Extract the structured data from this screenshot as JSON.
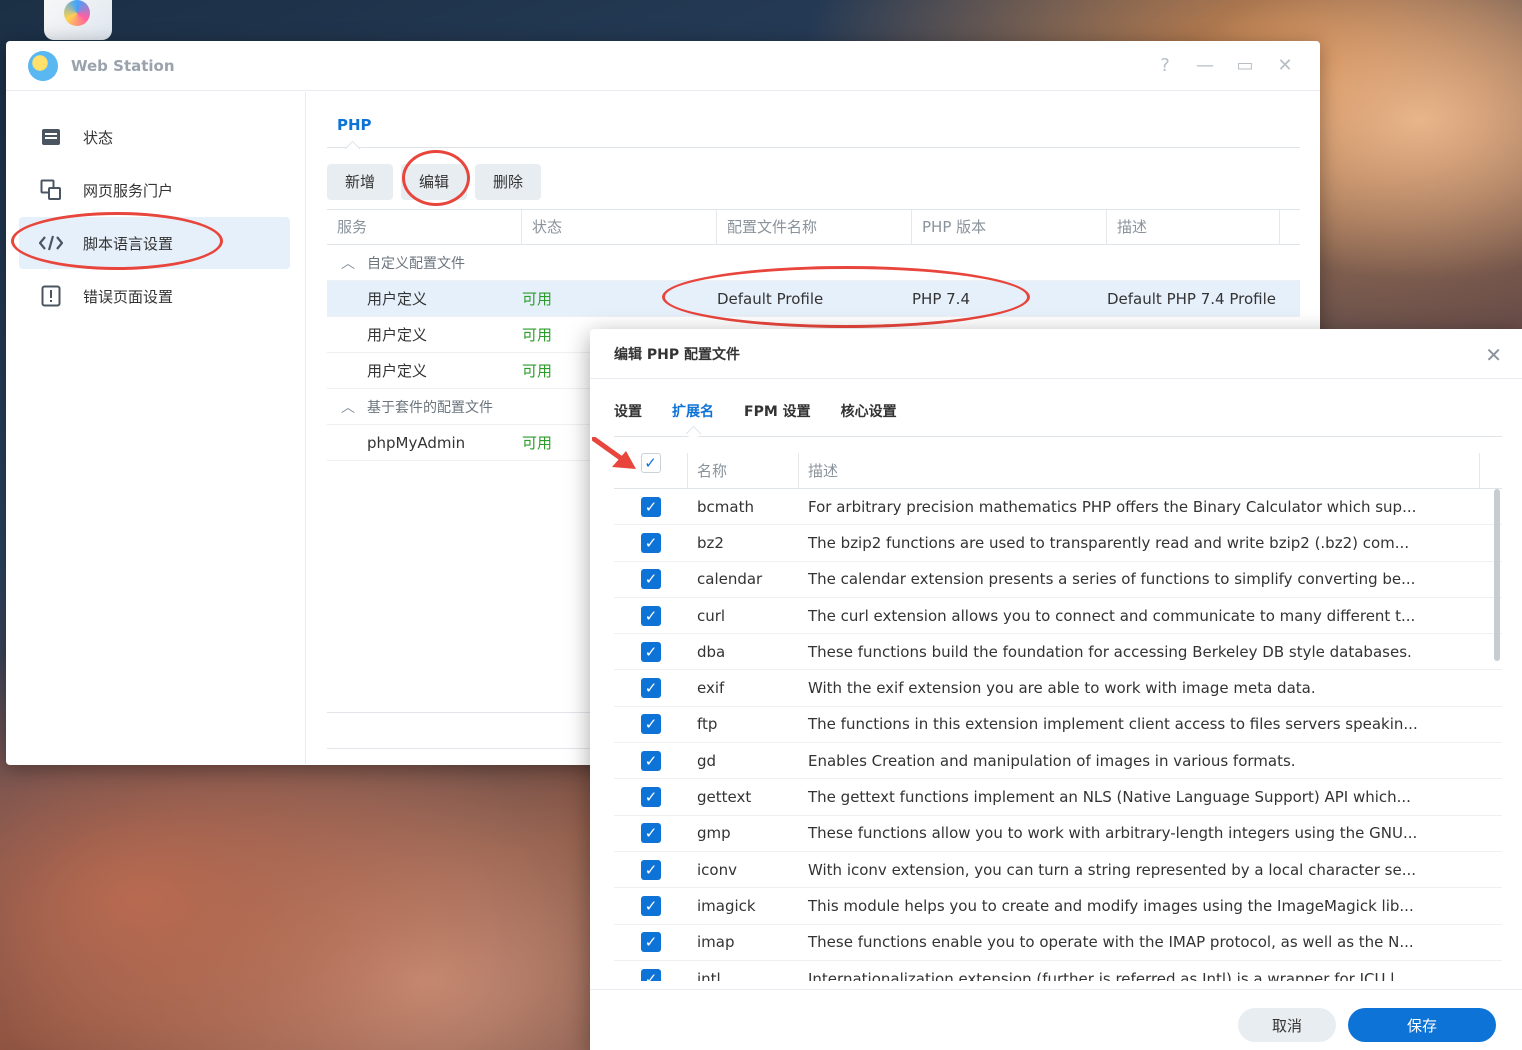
{
  "window": {
    "title": "Web Station",
    "controls": [
      "?",
      "—",
      "▭",
      "✕"
    ]
  },
  "sidebar": {
    "items": [
      {
        "label": "状态",
        "icon": "status-icon"
      },
      {
        "label": "网页服务门户",
        "icon": "portal-icon"
      },
      {
        "label": "脚本语言设置",
        "icon": "code-icon",
        "active": true
      },
      {
        "label": "错误页面设置",
        "icon": "error-page-icon"
      }
    ]
  },
  "main": {
    "tab": "PHP",
    "toolbar": {
      "add": "新增",
      "edit": "编辑",
      "delete": "删除"
    },
    "columns": [
      "服务",
      "状态",
      "配置文件名称",
      "PHP 版本",
      "描述"
    ],
    "groups": [
      {
        "label": "自定义配置文件",
        "rows": [
          {
            "service": "用户定义",
            "status": "可用",
            "profile": "Default Profile",
            "version": "PHP 7.4",
            "desc": "Default PHP 7.4 Profile"
          },
          {
            "service": "用户定义",
            "status": "可用",
            "profile": "",
            "version": "",
            "desc": ""
          },
          {
            "service": "用户定义",
            "status": "可用",
            "profile": "",
            "version": "",
            "desc": ""
          }
        ]
      },
      {
        "label": "基于套件的配置文件",
        "rows": [
          {
            "service": "phpMyAdmin",
            "status": "可用",
            "profile": "",
            "version": "",
            "desc": ""
          }
        ]
      }
    ]
  },
  "dialog": {
    "title": "编辑 PHP 配置文件",
    "close": "✕",
    "tabs": [
      "设置",
      "扩展名",
      "FPM 设置",
      "核心设置"
    ],
    "active_tab": "扩展名",
    "columns": {
      "name": "名称",
      "desc": "描述"
    },
    "extensions": [
      {
        "name": "bcmath",
        "desc": "For arbitrary precision mathematics PHP offers the Binary Calculator which sup..."
      },
      {
        "name": "bz2",
        "desc": "The bzip2 functions are used to transparently read and write bzip2 (.bz2) com..."
      },
      {
        "name": "calendar",
        "desc": "The calendar extension presents a series of functions to simplify converting be..."
      },
      {
        "name": "curl",
        "desc": "The curl extension allows you to connect and communicate to many different t..."
      },
      {
        "name": "dba",
        "desc": "These functions build the foundation for accessing Berkeley DB style databases."
      },
      {
        "name": "exif",
        "desc": "With the exif extension you are able to work with image meta data."
      },
      {
        "name": "ftp",
        "desc": "The functions in this extension implement client access to files servers speakin..."
      },
      {
        "name": "gd",
        "desc": "Enables Creation and manipulation of images in various formats."
      },
      {
        "name": "gettext",
        "desc": "The gettext functions implement an NLS (Native Language Support) API which..."
      },
      {
        "name": "gmp",
        "desc": "These functions allow you to work with arbitrary-length integers using the GNU..."
      },
      {
        "name": "iconv",
        "desc": "With iconv extension, you can turn a string represented by a local character se..."
      },
      {
        "name": "imagick",
        "desc": "This module helps you to create and modify images using the ImageMagick lib..."
      },
      {
        "name": "imap",
        "desc": "These functions enable you to operate with the IMAP protocol, as well as the N..."
      },
      {
        "name": "intl",
        "desc": "Internationalization extension (further is referred as Intl) is a wrapper for ICU l..."
      }
    ],
    "cancel": "取消",
    "save": "保存"
  },
  "colors": {
    "accent": "#0d73d6",
    "annotation": "#e8453c",
    "available": "#2a9c2a"
  }
}
